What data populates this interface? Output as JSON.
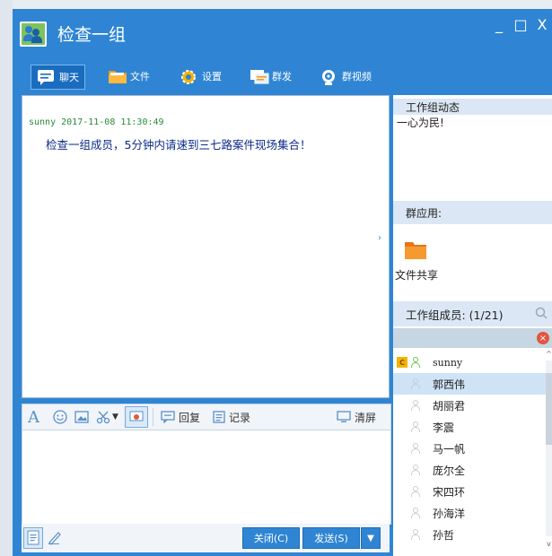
{
  "window": {
    "title": "检查一组",
    "controls": {
      "minimize": "_",
      "maximize": "□",
      "close": "X"
    }
  },
  "toolbar": {
    "items": [
      {
        "label": "聊天",
        "icon": "chat-icon",
        "active": true
      },
      {
        "label": "文件",
        "icon": "folder-icon"
      },
      {
        "label": "设置",
        "icon": "gear-icon"
      },
      {
        "label": "群发",
        "icon": "broadcast-icon"
      },
      {
        "label": "群视频",
        "icon": "video-icon"
      }
    ]
  },
  "chat": {
    "messages": [
      {
        "sender": "sunny",
        "time": "2017-11-08 11:30:49",
        "text": "检查一组成员，5分钟内请速到三七路案件现场集合！"
      }
    ]
  },
  "input_toolbar": {
    "reply_label": "回复",
    "record_label": "记录",
    "clear_label": "清屏",
    "font_glyph": "A"
  },
  "bottom": {
    "close_label": "关闭(C)",
    "send_label": "发送(S)"
  },
  "right_panel": {
    "news_header": "工作组动态",
    "news_text": "一心为民!",
    "apps_header": "群应用:",
    "apps": [
      {
        "label": "文件共享",
        "icon": "shared-folder-icon"
      }
    ],
    "members_header": "工作组成员: (1/21)",
    "members": [
      {
        "name": "sunny",
        "online": true,
        "creator_badge": "C"
      },
      {
        "name": "郭西伟",
        "online": false,
        "selected": true
      },
      {
        "name": "胡丽君",
        "online": false
      },
      {
        "name": "李震",
        "online": false
      },
      {
        "name": "马一帆",
        "online": false
      },
      {
        "name": "庞尔全",
        "online": false
      },
      {
        "name": "宋四环",
        "online": false
      },
      {
        "name": "孙海洋",
        "online": false
      },
      {
        "name": "孙哲",
        "online": false
      }
    ]
  },
  "colors": {
    "titlebar": "#2f85d3",
    "online": "#6cc24a",
    "offline": "#c3cdd7",
    "selected_row": "#cfe3f7",
    "message_meta": "#2a8a3a",
    "message_text": "#0a2a8a"
  }
}
